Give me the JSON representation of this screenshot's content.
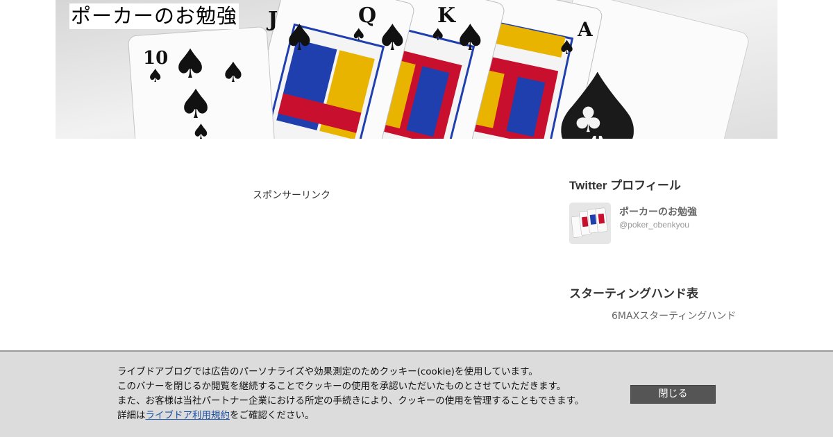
{
  "header": {
    "site_title": "ポーカーのお勉強",
    "card_ranks": [
      "10",
      "J",
      "Q",
      "K",
      "A"
    ]
  },
  "main": {
    "sponsor_label": "スポンサーリンク"
  },
  "sidebar": {
    "twitter": {
      "heading": "Twitter プロフィール",
      "name": "ポーカーのお勉強",
      "handle": "@poker_obenkyou"
    },
    "starting_hand": {
      "heading": "スターティングハンド表",
      "link_text": "6MAXスターティングハンド"
    }
  },
  "cookie_banner": {
    "line1": "ライブドアブログでは広告のパーソナライズや効果測定のためクッキー(cookie)を使用しています。",
    "line2": "このバナーを閉じるか閲覧を継続することでクッキーの使用を承認いただいたものとさせていただきます。",
    "line3": "また、お客様は当社パートナー企業における所定の手続きにより、クッキーの使用を管理することもできます。",
    "line4_prefix": "詳細は",
    "terms_link": "ライブドア利用規約",
    "line4_suffix": "をご確認ください。",
    "close_label": "閉じる"
  },
  "colors": {
    "card_red": "#c8102e",
    "card_blue": "#1f3fae",
    "card_gold": "#e8b400",
    "button_bg": "#555555",
    "banner_bg": "#dcdcdc",
    "link_blue": "#1a4fa0"
  }
}
